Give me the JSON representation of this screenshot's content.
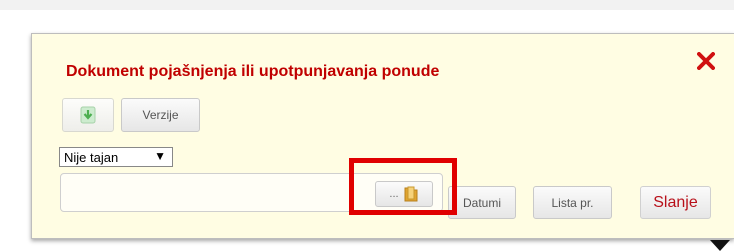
{
  "dialog": {
    "title": "Dokument pojašnjenja ili upotpunjavanja ponude",
    "close_icon": "close-x-icon"
  },
  "toolbar": {
    "download_icon": "download-arrow-icon",
    "versions_label": "Verzije"
  },
  "classification_select": {
    "selected": "Nije tajan",
    "arrow": "▼"
  },
  "file_upload": {
    "value": "",
    "browse_label": "...",
    "browse_icon": "folder-icon"
  },
  "actions": {
    "dates_label": "Datumi",
    "list_label": "Lista pr.",
    "send_label": "Slanje"
  },
  "highlight_color": "#e00000",
  "title_color": "#c00000"
}
